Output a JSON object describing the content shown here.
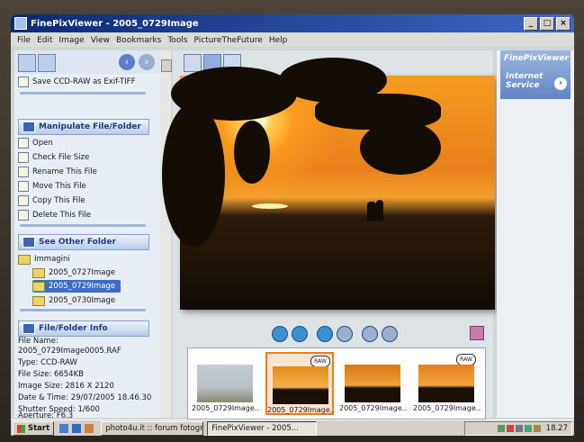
{
  "window": {
    "title": "FinePixViewer - 2005_0729Image"
  },
  "menu": [
    "File",
    "Edit",
    "Image",
    "View",
    "Bookmarks",
    "Tools",
    "PictureTheFuture",
    "Help"
  ],
  "left": {
    "top_item": "Save CCD-RAW as Exif-TIFF",
    "manipulate": {
      "title": "Manipulate File/Folder",
      "items": [
        "Open",
        "Check File Size",
        "Rename This File",
        "Move This File",
        "Copy This File",
        "Delete This File"
      ]
    },
    "other_folder": {
      "title": "See Other Folder",
      "root": "Immagini",
      "folders": [
        "2005_0727Image",
        "2005_0729Image",
        "2005_0730Image"
      ]
    },
    "info": {
      "title": "File/Folder Info",
      "lines": [
        "File Name:",
        "2005_0729Image0005.RAF",
        "Type: CCD-RAW",
        "File Size: 6654KB",
        "Image Size: 2816 X 2120",
        "Date & Time: 29/07/2005 18.46.30",
        "Shutter Speed: 1/600",
        "Aperture: F6.3"
      ]
    }
  },
  "thumbs": [
    {
      "caption": "2005_0729Image...",
      "raw": false
    },
    {
      "caption": "2005_0729Image...",
      "raw": true
    },
    {
      "caption": "2005_0729Image...",
      "raw": false
    },
    {
      "caption": "2005_0729Image...",
      "raw": true
    }
  ],
  "raw_label": "RAW",
  "right": {
    "brand": "FinePixViewer",
    "service": "Internet Service"
  },
  "taskbar": {
    "start": "Start",
    "tasks": [
      "photo4u.it :: forum fotografi...",
      "FinePixViewer - 2005..."
    ],
    "clock": "18.27"
  }
}
